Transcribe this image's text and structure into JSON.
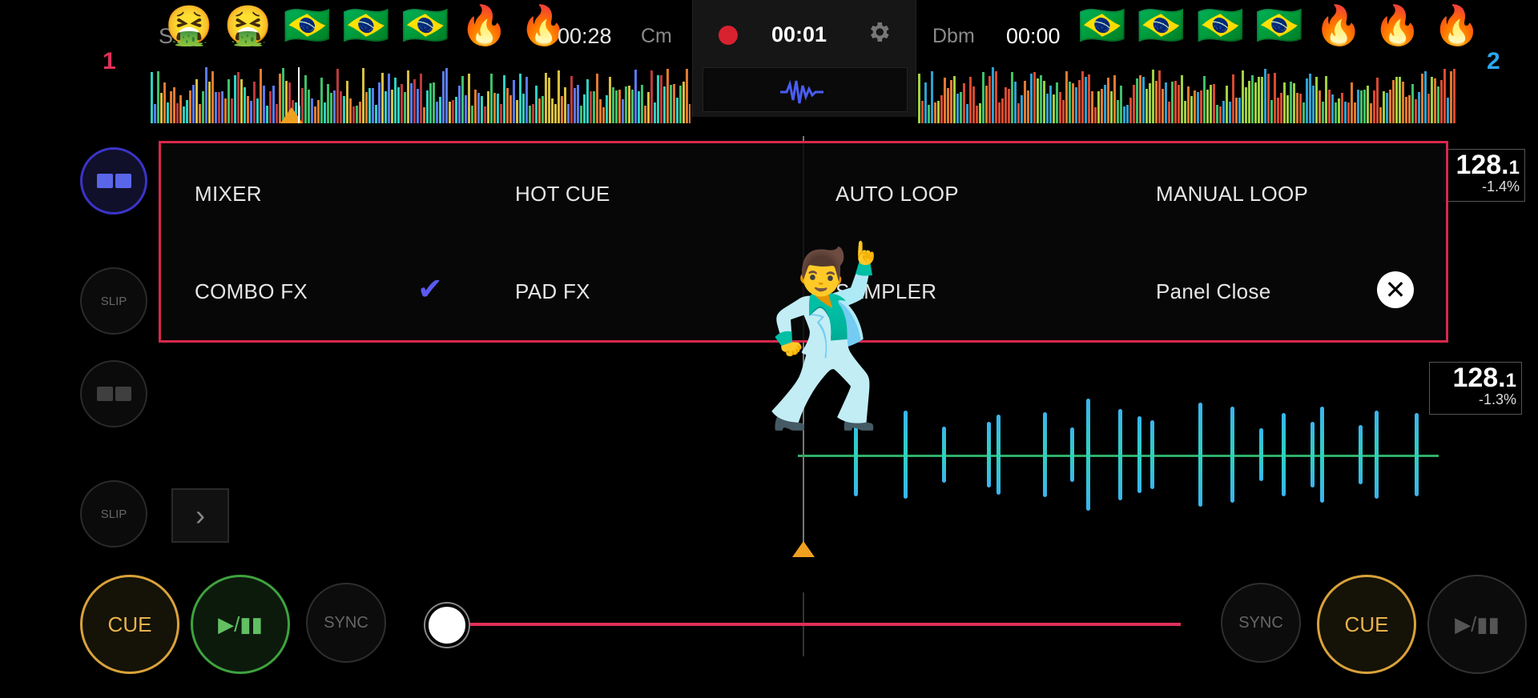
{
  "deck_left": {
    "number": "1",
    "time": "00:28",
    "key": "Cm",
    "title_partial": "S"
  },
  "deck_right": {
    "number": "2",
    "time": "00:00",
    "key": "Dbm"
  },
  "center": {
    "rec_time": "00:01"
  },
  "overlay_emojis": {
    "left": [
      "🤮",
      "🤮",
      "🇧🇷",
      "🇧🇷",
      "🇧🇷",
      "🔥",
      "🔥"
    ],
    "right": [
      "🇧🇷",
      "🇧🇷",
      "🇧🇷",
      "🇧🇷",
      "🔥",
      "🔥",
      "🔥"
    ],
    "dancer": "🕺"
  },
  "panel": {
    "items": [
      {
        "label": "MIXER"
      },
      {
        "label": "HOT CUE"
      },
      {
        "label": "AUTO LOOP"
      },
      {
        "label": "MANUAL LOOP"
      },
      {
        "label": "COMBO FX",
        "checked": true
      },
      {
        "label": "PAD FX"
      },
      {
        "label": "SAMPLER"
      },
      {
        "label": "Panel Close"
      }
    ],
    "check_glyph": "✔",
    "close_glyph": "✕"
  },
  "side_buttons": {
    "slip_label": "SLIP",
    "arrow_glyph": "›"
  },
  "bpm_top": {
    "main": "128.",
    "decimal": "1",
    "pct": "-1.4%"
  },
  "bpm_bottom": {
    "main": "128.",
    "decimal": "1",
    "pct": "-1.3%"
  },
  "controls": {
    "cue_label": "CUE",
    "play_label": "▶/▮▮",
    "sync_label": "SYNC",
    "crossfader_position": 0.03
  },
  "colors": {
    "accent": "#d8284c",
    "deck_left": "#e0305a",
    "deck_right": "#2aa9f0",
    "cue": "#d9a23a",
    "play": "#3fa23f"
  }
}
